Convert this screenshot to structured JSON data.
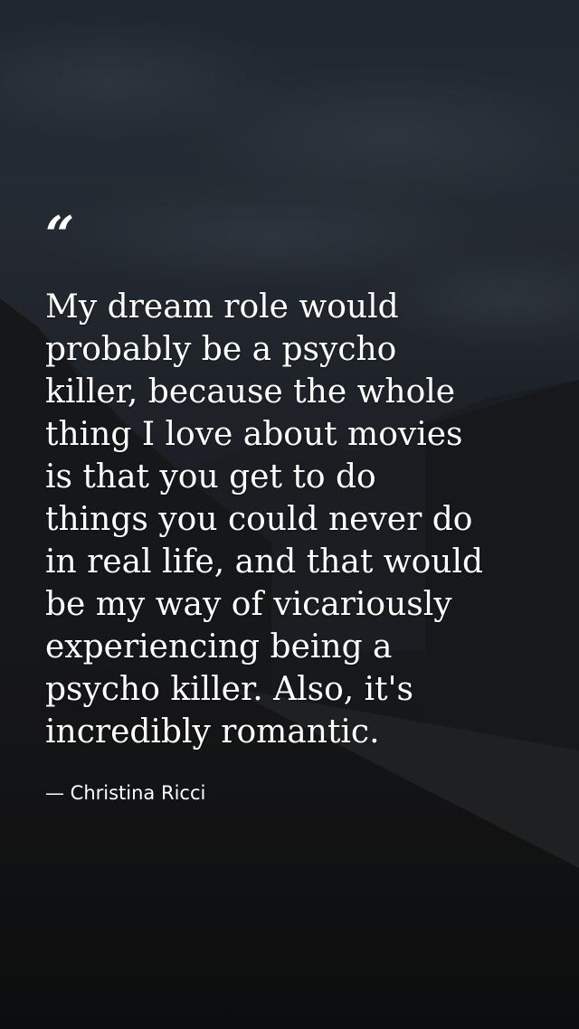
{
  "quote": {
    "mark": "“",
    "text": "My dream role would\nprobably be a psycho\nkiller, because the whole\nthing I love about movies\nis that you get to do\nthings you could never do\nin real life, and that would\nbe my way of vicariously\nexperiencing being a\npsycho killer. Also, it's\nincredibly romantic.",
    "author": "— Christina Ricci"
  },
  "colors": {
    "text": "#ffffff",
    "sky": "#2f3743",
    "ground": "#151618"
  }
}
